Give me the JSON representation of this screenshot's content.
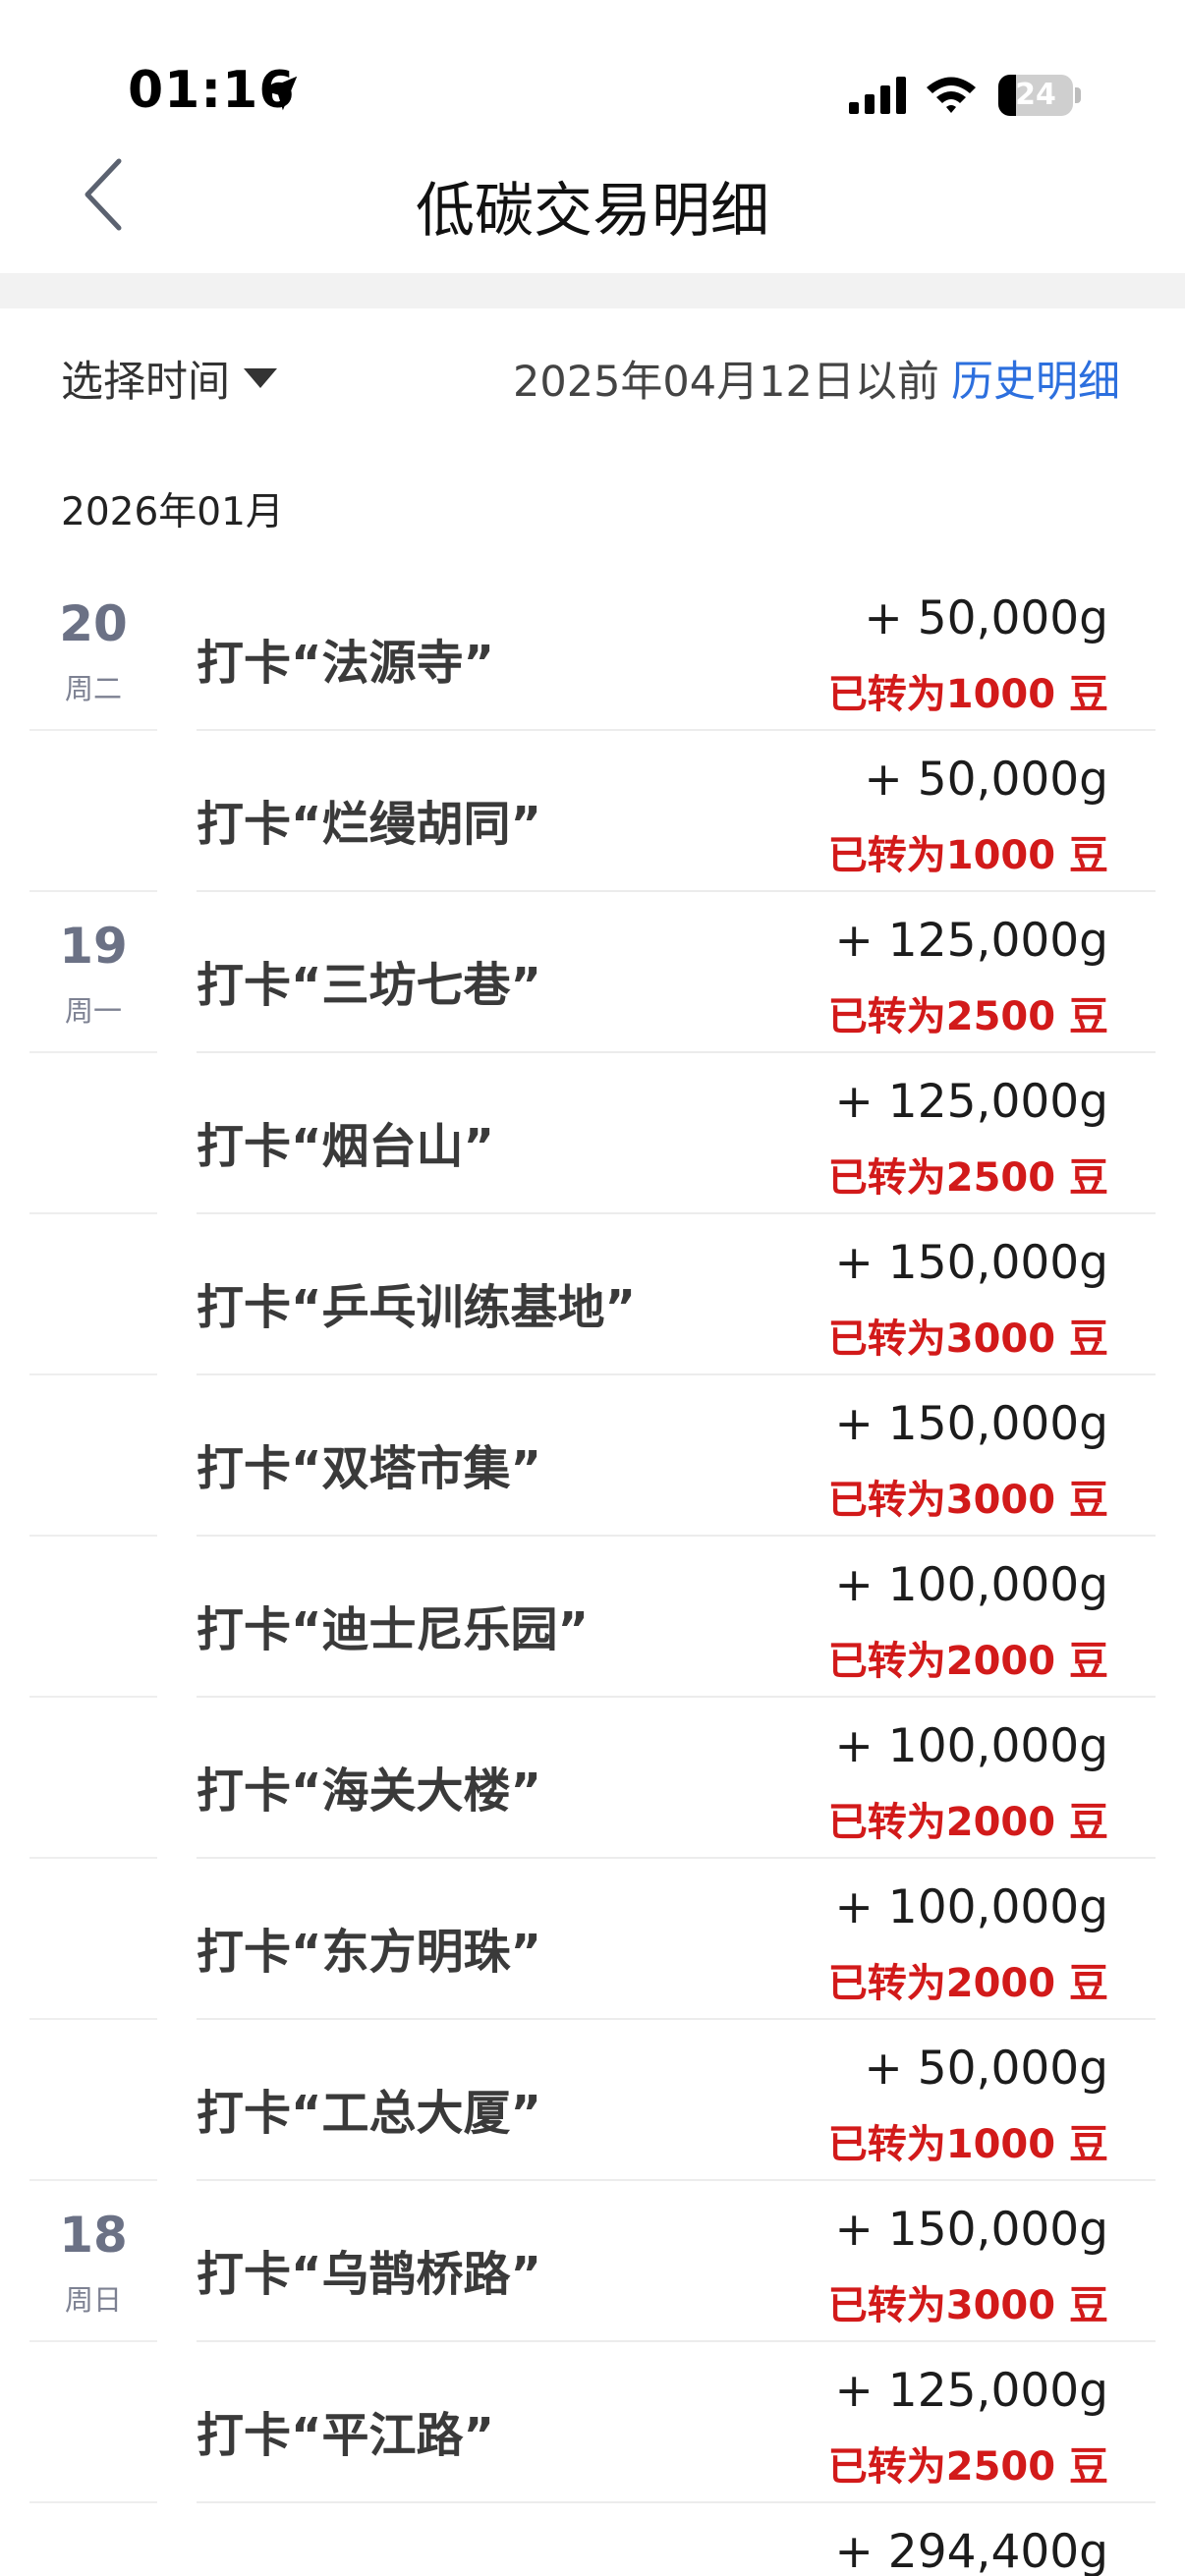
{
  "status_bar": {
    "time": "01:16",
    "battery": "24",
    "battery_level": 0.24
  },
  "header": {
    "title": "低碳交易明细"
  },
  "filter": {
    "select_label": "选择时间",
    "date_note": "2025年04月12日以前",
    "history_link": "历史明细"
  },
  "month": "2026年01月",
  "records": [
    {
      "day": "20",
      "weekday": "周二",
      "title": "打卡“法源寺”",
      "amount": "+ 50,000g",
      "converted": "已转为1000 豆"
    },
    {
      "day": "",
      "weekday": "",
      "title": "打卡“烂缦胡同”",
      "amount": "+ 50,000g",
      "converted": "已转为1000 豆"
    },
    {
      "day": "19",
      "weekday": "周一",
      "title": "打卡“三坊七巷”",
      "amount": "+ 125,000g",
      "converted": "已转为2500 豆"
    },
    {
      "day": "",
      "weekday": "",
      "title": "打卡“烟台山”",
      "amount": "+ 125,000g",
      "converted": "已转为2500 豆"
    },
    {
      "day": "",
      "weekday": "",
      "title": "打卡“乒乓训练基地”",
      "amount": "+ 150,000g",
      "converted": "已转为3000 豆"
    },
    {
      "day": "",
      "weekday": "",
      "title": "打卡“双塔市集”",
      "amount": "+ 150,000g",
      "converted": "已转为3000 豆"
    },
    {
      "day": "",
      "weekday": "",
      "title": "打卡“迪士尼乐园”",
      "amount": "+ 100,000g",
      "converted": "已转为2000 豆"
    },
    {
      "day": "",
      "weekday": "",
      "title": "打卡“海关大楼”",
      "amount": "+ 100,000g",
      "converted": "已转为2000 豆"
    },
    {
      "day": "",
      "weekday": "",
      "title": "打卡“东方明珠”",
      "amount": "+ 100,000g",
      "converted": "已转为2000 豆"
    },
    {
      "day": "",
      "weekday": "",
      "title": "打卡“工总大厦”",
      "amount": "+ 50,000g",
      "converted": "已转为1000 豆"
    },
    {
      "day": "18",
      "weekday": "周日",
      "title": "打卡“乌鹊桥路”",
      "amount": "+ 150,000g",
      "converted": "已转为3000 豆"
    },
    {
      "day": "",
      "weekday": "",
      "title": "打卡“平江路”",
      "amount": "+ 125,000g",
      "converted": "已转为2500 豆"
    },
    {
      "day": "",
      "weekday": "",
      "title": "",
      "amount": "+ 294,400g",
      "converted": ""
    }
  ]
}
